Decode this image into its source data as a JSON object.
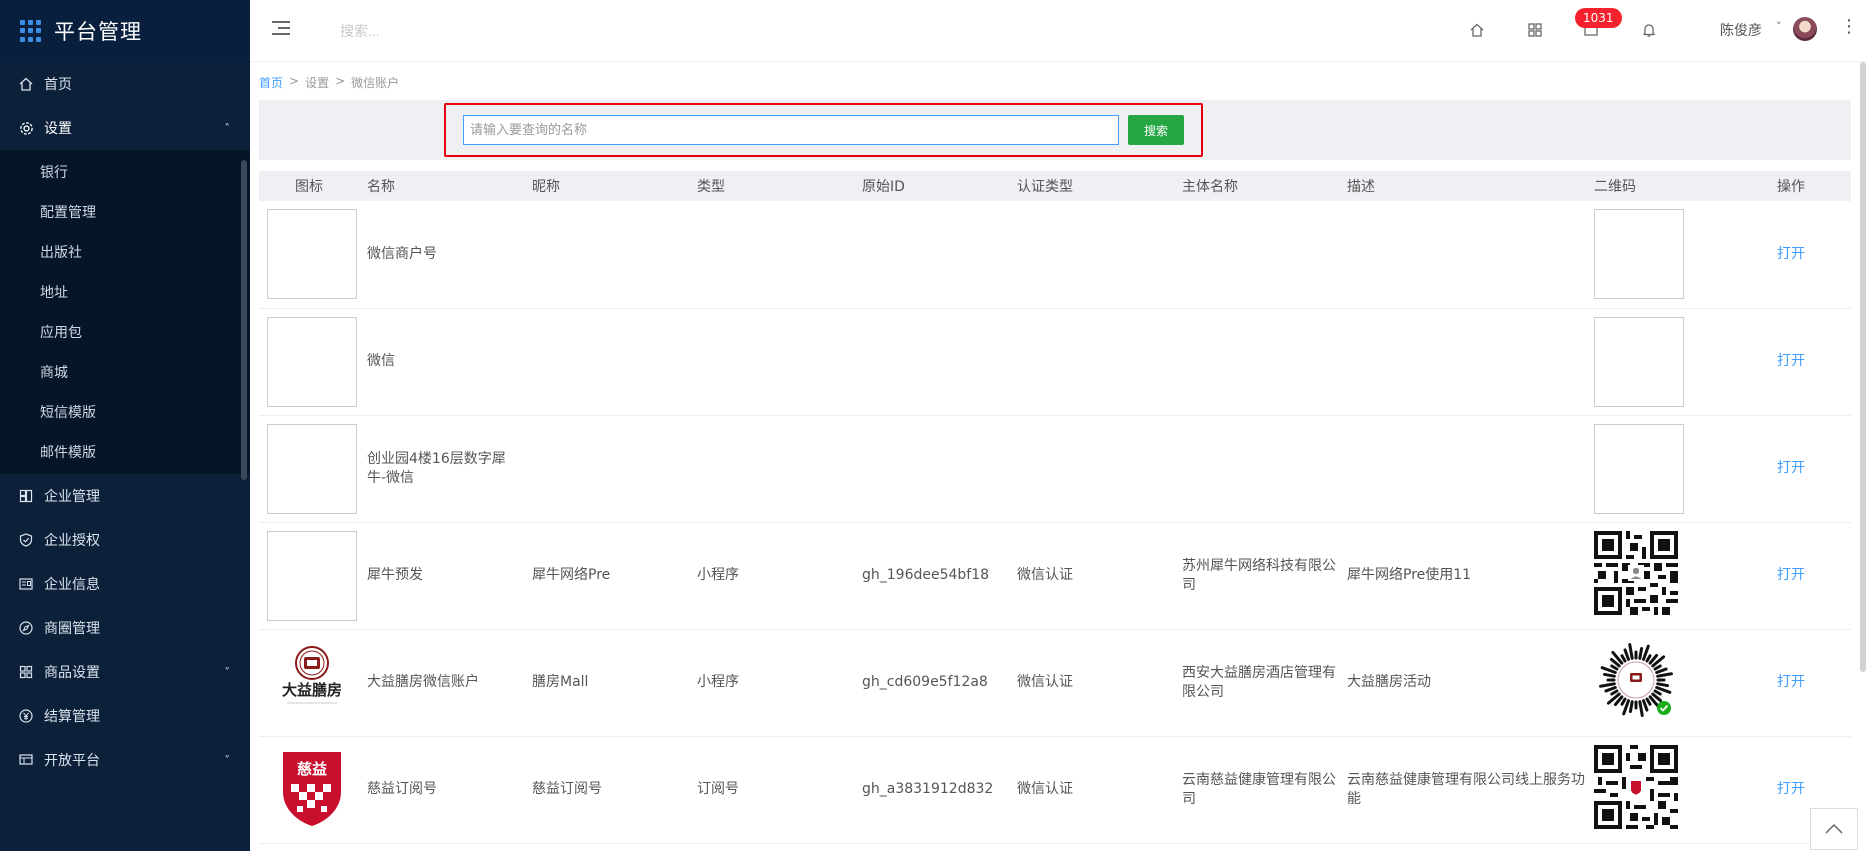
{
  "brand": {
    "title": "平台管理"
  },
  "sidebar": {
    "items": [
      {
        "label": "首页",
        "icon": "home-icon"
      },
      {
        "label": "设置",
        "icon": "gear-icon",
        "open": true,
        "children": [
          "银行",
          "配置管理",
          "出版社",
          "地址",
          "应用包",
          "商城",
          "短信模版",
          "邮件模版"
        ]
      },
      {
        "label": "企业管理",
        "icon": "building-icon"
      },
      {
        "label": "企业授权",
        "icon": "shield-check-icon"
      },
      {
        "label": "企业信息",
        "icon": "id-card-icon"
      },
      {
        "label": "商圈管理",
        "icon": "compass-icon"
      },
      {
        "label": "商品设置",
        "icon": "grid-icon",
        "expandable": true
      },
      {
        "label": "结算管理",
        "icon": "yen-icon"
      },
      {
        "label": "开放平台",
        "icon": "monitor-icon",
        "expandable": true
      }
    ]
  },
  "topbar": {
    "search_placeholder": "搜索...",
    "badge_count": "1031",
    "username": "陈俊彦"
  },
  "breadcrumb": {
    "home": "首页",
    "sep": ">",
    "level1": "设置",
    "level2": "微信账户"
  },
  "search": {
    "placeholder": "请输入要查询的名称",
    "button": "搜索"
  },
  "table": {
    "headers": [
      "图标",
      "名称",
      "昵称",
      "类型",
      "原始ID",
      "认证类型",
      "主体名称",
      "描述",
      "二维码",
      "操作"
    ],
    "rows": [
      {
        "name": "微信商户号",
        "nickname": "",
        "type": "",
        "original_id": "",
        "auth_type": "",
        "entity": "",
        "desc": "",
        "logo": "empty",
        "qr": "empty",
        "action": "打开"
      },
      {
        "name": "微信",
        "nickname": "",
        "type": "",
        "original_id": "",
        "auth_type": "",
        "entity": "",
        "desc": "",
        "logo": "empty",
        "qr": "empty",
        "action": "打开"
      },
      {
        "name": "创业园4楼16层数字犀牛-微信",
        "nickname": "",
        "type": "",
        "original_id": "",
        "auth_type": "",
        "entity": "",
        "desc": "",
        "logo": "empty",
        "qr": "empty",
        "action": "打开"
      },
      {
        "name": "犀牛预发",
        "nickname": "犀牛网络Pre",
        "type": "小程序",
        "original_id": "gh_196dee54bf18",
        "auth_type": "微信认证",
        "entity": "苏州犀牛网络科技有限公司",
        "desc": "犀牛网络Pre使用11",
        "logo": "empty",
        "qr": "qr-code",
        "action": "打开"
      },
      {
        "name": "大益膳房微信账户",
        "nickname": "膳房Mall",
        "type": "小程序",
        "original_id": "gh_cd609e5f12a8",
        "auth_type": "微信认证",
        "entity": "西安大益膳房酒店管理有限公司",
        "desc": "大益膳房活动",
        "logo": "dayi-logo",
        "logo_text": "大益膳房",
        "qr": "mini-program-code",
        "action": "打开"
      },
      {
        "name": "慈益订阅号",
        "nickname": "慈益订阅号",
        "type": "订阅号",
        "original_id": "gh_a3831912d832",
        "auth_type": "微信认证",
        "entity": "云南慈益健康管理有限公司",
        "desc": "云南慈益健康管理有限公司线上服务功能",
        "logo": "ciyi-logo",
        "logo_text": "慈益",
        "qr": "qr-code",
        "action": "打开"
      }
    ]
  },
  "colors": {
    "sidebar_bg": "#0c2039",
    "accent": "#409eff",
    "search_button": "#25a844",
    "highlight_border": "#e60012",
    "badge": "#f5222d"
  }
}
